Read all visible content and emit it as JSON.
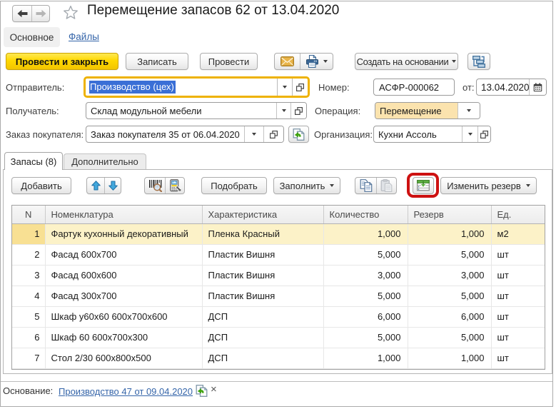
{
  "theme": {
    "accent-yellow": "#ffd800",
    "focus-ring": "#eeb200",
    "selection-blue": "#3a6fd6",
    "row-highlight": "#fcf2c8",
    "row-highlight-cell": "#f8e093",
    "operation-bg": "#fbe3ae",
    "annotation-red": "#cd1111",
    "link-blue": "#3565a9"
  },
  "header": {
    "title": "Перемещение запасов 62 от 13.04.2020",
    "tab_main": "Основное",
    "tab_files": "Файлы"
  },
  "command_bar": {
    "post_and_close": "Провести и закрыть",
    "save": "Записать",
    "post": "Провести",
    "create_based_on": "Создать на основании"
  },
  "fields": {
    "sender": {
      "label": "Отправитель:",
      "value": "Производство (цех)"
    },
    "receiver": {
      "label": "Получатель:",
      "value": "Склад модульной мебели"
    },
    "customer_order": {
      "label": "Заказ покупателя:",
      "value": "Заказ покупателя 35 от 06.04.2020"
    },
    "number": {
      "label": "Номер:",
      "value": "АСФР-000062"
    },
    "date": {
      "label": "от:",
      "value": "13.04.2020"
    },
    "operation": {
      "label": "Операция:",
      "value": "Перемещение"
    },
    "organization": {
      "label": "Организация:",
      "value": "Кухни Ассоль"
    }
  },
  "tabs": {
    "inventory": "Запасы (8)",
    "additional": "Дополнительно"
  },
  "table_toolbar": {
    "add": "Добавить",
    "pick": "Подобрать",
    "fill": "Заполнить",
    "change_reserve": "Изменить резерв"
  },
  "table": {
    "headers": {
      "n": "N",
      "item": "Номенклатура",
      "characteristic": "Характеристика",
      "quantity": "Количество",
      "reserve": "Резерв",
      "unit": "Ед."
    },
    "rows": [
      {
        "n": "1",
        "item": "Фартук кухонный декоративный",
        "characteristic": "Пленка Красный",
        "quantity": "1,000",
        "reserve": "1,000",
        "unit": "м2"
      },
      {
        "n": "2",
        "item": "Фасад 600х700",
        "characteristic": "Пластик Вишня",
        "quantity": "5,000",
        "reserve": "5,000",
        "unit": "шт"
      },
      {
        "n": "3",
        "item": "Фасад 600х600",
        "characteristic": "Пластик Вишня",
        "quantity": "3,000",
        "reserve": "3,000",
        "unit": "шт"
      },
      {
        "n": "4",
        "item": "Фасад 300х700",
        "characteristic": "Пластик Вишня",
        "quantity": "5,000",
        "reserve": "5,000",
        "unit": "шт"
      },
      {
        "n": "5",
        "item": "Шкаф у60х60 600х700х600",
        "characteristic": "ДСП",
        "quantity": "6,000",
        "reserve": "6,000",
        "unit": "шт"
      },
      {
        "n": "6",
        "item": "Шкаф 60 600х700х300",
        "characteristic": "ДСП",
        "quantity": "5,000",
        "reserve": "5,000",
        "unit": "шт"
      },
      {
        "n": "7",
        "item": "Стол 2/30 600х800х500",
        "characteristic": "ДСП",
        "quantity": "1,000",
        "reserve": "1,000",
        "unit": "шт"
      }
    ]
  },
  "footer": {
    "base_label": "Основание:",
    "base_link": "Производство 47 от 09.04.2020",
    "clear": "×"
  },
  "icons": {
    "back-icon": "left arrow",
    "forward-icon": "right arrow",
    "favorite-star-icon": "star outline",
    "mail-icon": "orange envelope",
    "print-icon": "printer",
    "related-documents-icon": "linked boxes hierarchy",
    "dropdown-icon": "small down triangle",
    "open-icon": "two overlapping squares",
    "calendar-icon": "calendar",
    "based-on-icon": "pages with green arrow",
    "move-up-icon": "blue up arrow",
    "move-down-icon": "blue down arrow",
    "barcode-icon": "barcode with magnifier",
    "scanner-icon": "data terminal with arrow",
    "copy-icon": "two documents",
    "paste-icon": "clipboard (disabled)",
    "load-table-icon": "table with green arrow",
    "clear-icon": "small cross"
  }
}
